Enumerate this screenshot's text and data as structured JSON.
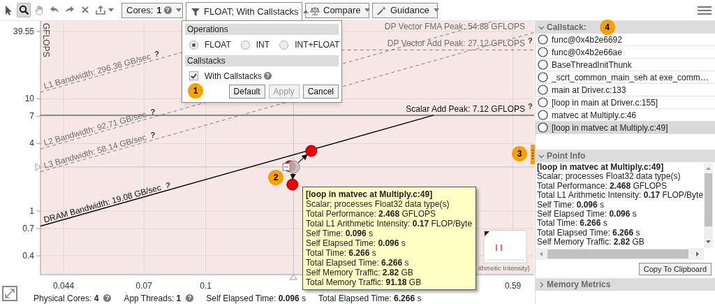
{
  "toolbar": {
    "tools": [
      {
        "kind": "pointer",
        "selected": false
      },
      {
        "kind": "zoom",
        "selected": true
      },
      {
        "kind": "pan",
        "selected": false
      },
      {
        "kind": "undo",
        "selected": false
      },
      {
        "kind": "redo",
        "selected": false
      },
      {
        "kind": "clear",
        "selected": false
      },
      {
        "kind": "export",
        "selected": false
      }
    ],
    "dropdowns": [
      {
        "kind": "cores",
        "label": "Cores:",
        "value": "1",
        "help": "?",
        "expanded": false
      },
      {
        "kind": "filter",
        "label": "FLOAT; With Callstacks",
        "expanded": true
      },
      {
        "kind": "compare",
        "label": "Compare",
        "expanded": false
      },
      {
        "kind": "guidance",
        "label": "Guidance",
        "expanded": false
      }
    ]
  },
  "filter_panel": {
    "sections": [
      {
        "title": "Operations",
        "kind": "radio",
        "options": [
          {
            "label": "FLOAT",
            "selected": true
          },
          {
            "label": "INT",
            "selected": false
          },
          {
            "label": "INT+FLOAT",
            "selected": false
          }
        ]
      },
      {
        "title": "Callstacks",
        "kind": "checkbox",
        "options": [
          {
            "label": "With Callstacks",
            "checked": true,
            "help": "?"
          }
        ]
      }
    ],
    "buttons": [
      {
        "label": "Default",
        "disabled": false
      },
      {
        "label": "Apply",
        "disabled": true
      },
      {
        "label": "Cancel",
        "disabled": false
      }
    ],
    "callout": "1"
  },
  "chart": {
    "callout": "2",
    "y_title": "GFLOPS",
    "x_title": "ithmetic Intensity)",
    "y_ticks": [
      "39.55",
      "10",
      "7",
      "4",
      "1",
      "0.7",
      "0.4"
    ],
    "x_ticks": [
      "0.044",
      "0.07",
      "0.1",
      "0.59"
    ],
    "roofs": [
      {
        "label": "DP Vector FMA Peak: 54.88 GFLOPS"
      },
      {
        "label": "DP Vector Add Peak: 27.12 GFLOPS",
        "help": "?"
      },
      {
        "label": "Scalar Add Peak: 7.12 GFLOPS",
        "help": "?"
      },
      {
        "label": "L1 Bandwidth: 296.36 GB/sec",
        "help": "?"
      },
      {
        "label": "L2 Bandwidth: 92.71 GB/sec",
        "help": "?"
      },
      {
        "label": "L3 Bandwidth: 58.14 GB/sec",
        "help": "?"
      },
      {
        "label": "DRAM Bandwidth: 19.08 GB/sec",
        "help": "?"
      }
    ]
  },
  "tooltip": {
    "title": "[loop in matvec at Multiply.c:49]",
    "lines": [
      "Scalar; processes Float32 data type(s)",
      "Total Performance: **2.468** GFLOPS",
      "Total L1 Arithmetic Intensity: **0.17** FLOP/Byte",
      "Self Time: **0.096** s",
      "Self Elapsed Time: **0.096** s",
      "Total Time: **6.266** s",
      "Total Elapsed Time: **6.266** s",
      "Self Memory Traffic: **2.82** GB",
      "Total Memory Traffic: **91.18** GB"
    ]
  },
  "status_bar": [
    {
      "text": "Physical Cores: **4**",
      "help": "?"
    },
    {
      "text": "App Threads: **1**",
      "help": "?"
    },
    {
      "text": "Self Elapsed Time: **0.096** s"
    },
    {
      "text": "Total Elapsed Time: **6.266** s"
    }
  ],
  "callstack": {
    "title": "Callstack:",
    "expanded": true,
    "callout": "4",
    "rows": [
      {
        "label": "func@0x4b2e6692",
        "selected": false
      },
      {
        "label": "func@0x4b2e66ae",
        "selected": false
      },
      {
        "label": "BaseThreadInitThunk",
        "selected": false
      },
      {
        "label": "_scrt_common_main_seh at exe_comm…",
        "selected": false
      },
      {
        "label": "main at Driver.c:133",
        "selected": false
      },
      {
        "label": "[loop in main at Driver.c:155]",
        "selected": false
      },
      {
        "label": "matvec at Multiply.c:46",
        "selected": false
      },
      {
        "label": "[loop in matvec at Multiply.c:49]",
        "selected": true
      }
    ]
  },
  "splitter": {
    "callout": "3"
  },
  "point_info": {
    "title": "Point Info",
    "expanded": true,
    "heading": "[loop in matvec at Multiply.c:49]",
    "lines": [
      "Scalar; processes Float32 data type(s)",
      "Total Performance: **2.468** GFLOPS",
      "Total L1 Arithmetic Intensity: **0.17** FLOP/Byte",
      "Self Time: **0.096** s",
      "Self Elapsed Time: **0.096** s",
      "Total Time: **6.266** s",
      "Total Elapsed Time: **6.266** s",
      "Self Memory Traffic: **2.82** GB"
    ]
  },
  "copy_button": "Copy To Clipboard",
  "memory_metrics": {
    "title": "Memory Metrics",
    "expanded": false
  }
}
